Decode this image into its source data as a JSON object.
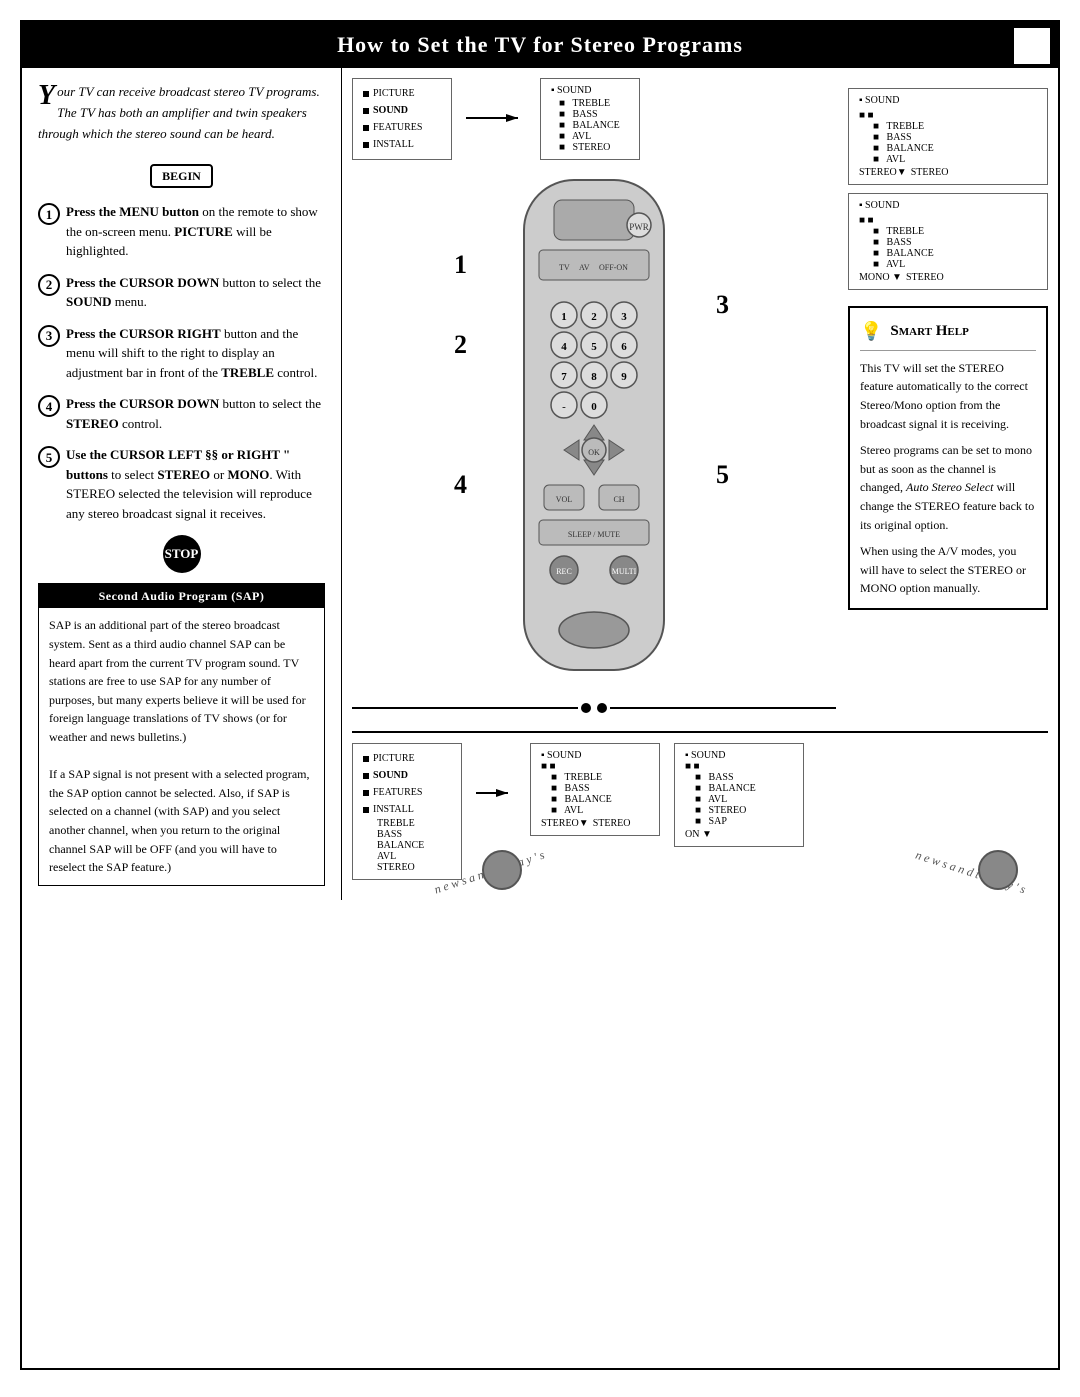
{
  "header": {
    "title": "How to Set the TV for Stereo Programs"
  },
  "intro": {
    "big_letter": "Y",
    "text": "our TV can receive broadcast stereo TV programs. The TV has both an amplifier and twin speakers through which the stereo sound can be heard."
  },
  "begin_label": "BEGIN",
  "steps": [
    {
      "num": "1",
      "text_bold": "Press the MENU button",
      "text": " on the remote to show the on-screen menu. ",
      "text_bold2": "PICTURE",
      "text2": " will be highlighted."
    },
    {
      "num": "2",
      "text_bold": "Press the CURSOR DOWN",
      "text": " button to select the ",
      "text_bold2": "SOUND",
      "text2": " menu."
    },
    {
      "num": "3",
      "text_bold": "Press the CURSOR RIGHT",
      "text": " button and the menu will shift to the right to display an adjustment bar in front of the ",
      "text_bold2": "TREBLE",
      "text2": " control."
    },
    {
      "num": "4",
      "text_bold": "Press the CURSOR DOWN",
      "text": " button to select the ",
      "text_bold2": "STEREO",
      "text2": " control."
    },
    {
      "num": "5",
      "text_bold": "Use the CURSOR LEFT §§ or RIGHT “",
      "text": "  buttons to select ",
      "text_bold2": "STEREO",
      "text2": " or ",
      "text_bold3": "MONO",
      "text3": ". With STEREO selected the television will reproduce any stereo broadcast signal it receives."
    }
  ],
  "stop_label": "STOP",
  "sap": {
    "header": "Second Audio Program (SAP)",
    "paragraphs": [
      "SAP is an additional part of the stereo broadcast system. Sent as a third audio channel SAP can be heard apart from the current TV program sound. TV stations are free to use SAP for any number of purposes, but many experts believe it will be used for foreign language translations of TV shows (or for weather and news bulletins.)",
      " If a SAP signal is not present with a selected program, the SAP option cannot be selected. Also, if SAP is selected on a channel (with SAP) and you select another channel, when you return to the original channel SAP will be OFF (and you will have to reselect the SAP feature.)"
    ]
  },
  "menu_left_top": {
    "items": [
      {
        "bullet": "▪",
        "label": "PICTURE"
      },
      {
        "bullet": "▪",
        "label": "SOUND"
      },
      {
        "bullet": "▪",
        "label": "FEATURES"
      },
      {
        "bullet": "▪",
        "label": "INSTALL"
      }
    ],
    "sub_items": [
      "TREBLE",
      "BASS",
      "BALANCE",
      "AVL",
      "STEREO"
    ]
  },
  "menu_right_top1": {
    "header": "▪ SOUND",
    "items": [
      "TREBLE",
      "BASS",
      "BALANCE",
      "AVL",
      "STEREO"
    ],
    "mono_label": "STEREO"
  },
  "menu_right_top2": {
    "header": "▪ SOUND",
    "items": [
      "TREBLE",
      "BASS",
      "BALANCE",
      "AVL",
      "STEREO"
    ],
    "mono_label": "MONO"
  },
  "smart_help": {
    "title": "Smart Help",
    "paragraphs": [
      "This TV will set the STEREO feature automatically to the correct Stereo/Mono option from the broadcast signal it is receiving.",
      "Stereo programs can be set to mono but as soon as the channel is changed, Auto Stereo Select will change the STEREO feature back to its original option.",
      "When using the A/V modes, you will have to select the STEREO or MONO option manually."
    ],
    "italic_phrase": "Auto Stereo Select"
  },
  "bottom": {
    "menu_left": {
      "items": [
        {
          "bullet": "▪",
          "label": "PICTURE"
        },
        {
          "bullet": "▪",
          "label": "SOUND"
        },
        {
          "bullet": "▪",
          "label": "FEATURES"
        },
        {
          "bullet": "▪",
          "label": "INSTALL"
        }
      ],
      "sub_items": [
        "TREBLE",
        "BASS",
        "BALANCE",
        "AVL",
        "STEREO"
      ]
    },
    "menu_right1": {
      "header": "▪ SOUND",
      "items": [
        "TREBLE",
        "BASS",
        "BALANCE",
        "AVL",
        "STEREO"
      ],
      "mono_label": "STEREO"
    },
    "menu_right2": {
      "header": "▪ SOUND",
      "items": [
        "BASS",
        "BALANCE",
        "AVL",
        "STEREO",
        "SAP"
      ],
      "on_label": "ON"
    },
    "angled_left": "n e w s  a n d  t o d a y ' s",
    "angled_right": "n e w s  a n d  t o d a y ' s"
  },
  "step_labels_remote": [
    "1",
    "2",
    "3",
    "4",
    "5"
  ]
}
